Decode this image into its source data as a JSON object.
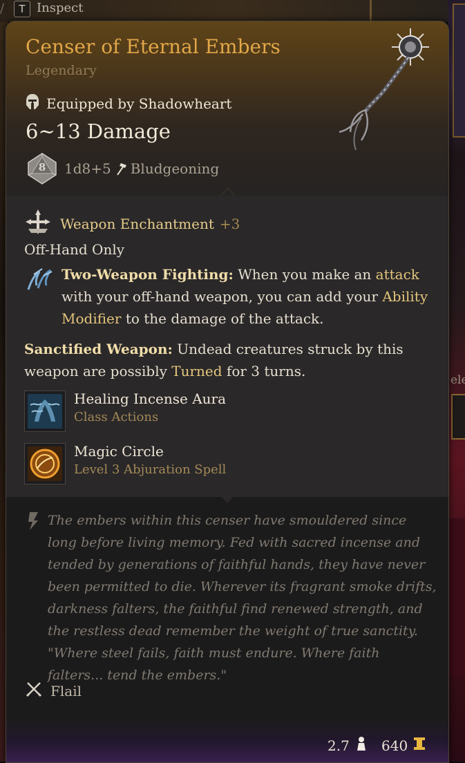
{
  "inspect": {
    "key": "T",
    "label": "Inspect"
  },
  "item": {
    "name": "Censer of Eternal Embers",
    "rarity": "Legendary",
    "equipped_by": "Equipped by Shadowheart",
    "damage": "6~13 Damage",
    "die_face": "8",
    "damage_dice": "1d8+5",
    "damage_type": "Bludgeoning"
  },
  "properties": {
    "enchantment_label": "Weapon Enchantment",
    "enchantment_bonus": "+3",
    "off_hand": "Off-Hand Only",
    "twf": {
      "title": "Two-Weapon Fighting:",
      "text_1": " When you make an ",
      "hl_1": "attack",
      "text_2": " with your off-hand weapon, you can add your ",
      "hl_2": "Ability Modifier",
      "text_3": " to the damage of the attack."
    },
    "sanctified": {
      "title": "Sanctified Weapon:",
      "text_1": " Undead creatures struck by this weapon are possibly ",
      "hl_1": "Turned",
      "text_2": " for 3 turns."
    }
  },
  "spells": [
    {
      "name": "Healing Incense Aura",
      "subtitle": "Class Actions",
      "icon": "incense-aura-icon"
    },
    {
      "name": "Magic Circle",
      "subtitle": "Level 3 Abjuration Spell",
      "icon": "magic-circle-icon"
    }
  ],
  "lore": "The embers within this censer have smouldered since long before living memory. Fed with sacred incense and tended by generations of faithful hands, they have never been permitted to die. Wherever its fragrant smoke drifts, darkness falters, the faithful find renewed strength, and the restless dead remember the weight of true sanctity.  \"Where steel fails, faith must endure. Where faith falters... tend the embers.\"",
  "weapon_type": "Flail",
  "footer": {
    "weight": "2.7",
    "price": "640"
  },
  "background": {
    "partial_text": "ele"
  },
  "colors": {
    "item_name": "#e1a748",
    "highlight": "#e4c67c",
    "rarity": "#8f7a55"
  }
}
